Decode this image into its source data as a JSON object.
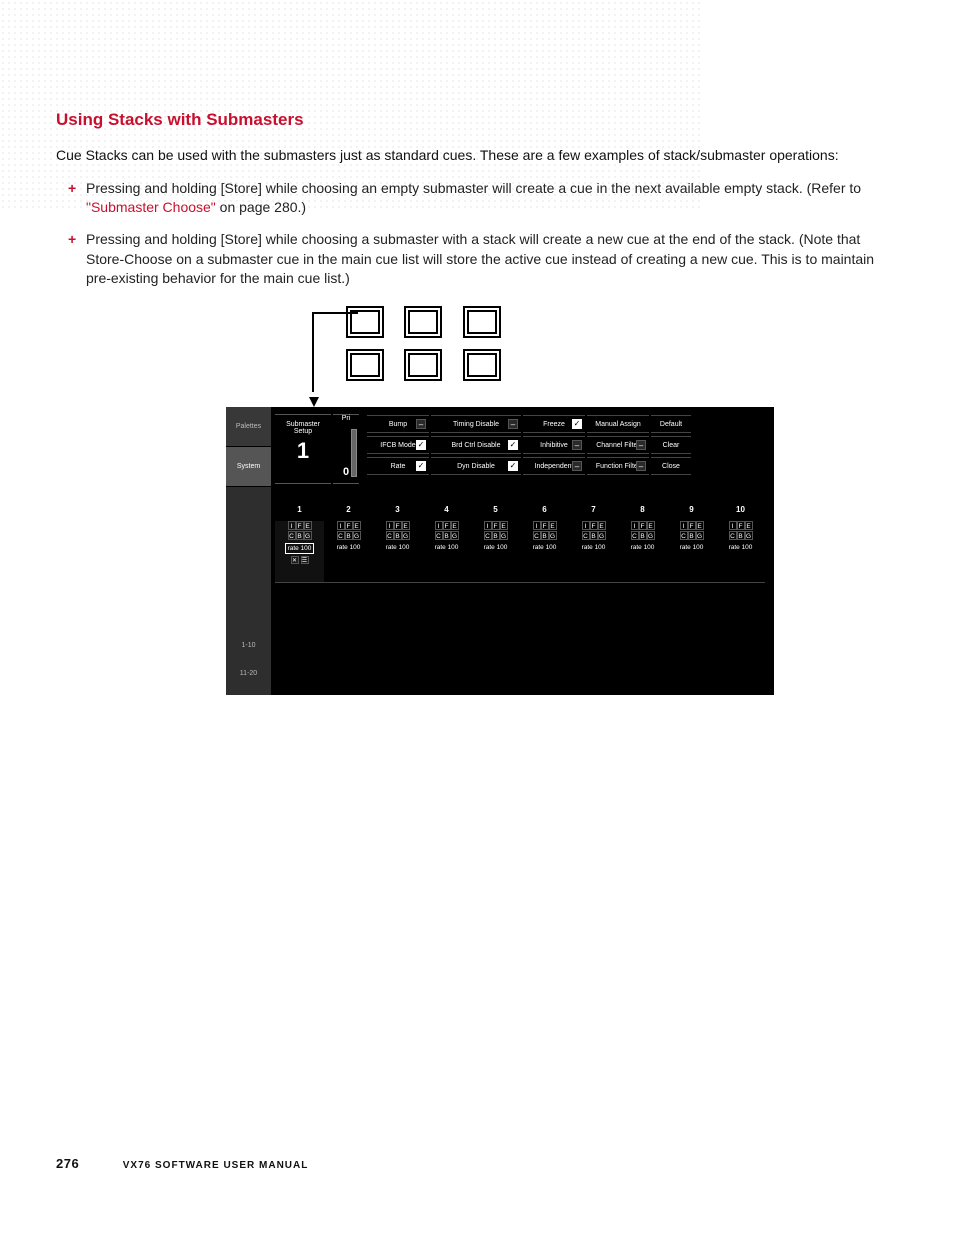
{
  "page": {
    "number": "276",
    "manual": "VX76 SOFTWARE USER MANUAL"
  },
  "heading": "Using Stacks with Submasters",
  "intro": "Cue Stacks can be used with the submasters just as standard cues. These are a few examples of stack/submaster operations:",
  "bullets": [
    {
      "pre": "Pressing and holding [Store] while choosing an empty submaster will create a cue in the next available empty stack. (Refer to ",
      "link": "\"Submaster Choose\"",
      "post": " on page 280.)"
    },
    {
      "pre": "Pressing and holding [Store] while choosing a submaster with a stack will create a new cue at the end of the stack. (Note that Store-Choose on a submaster cue in the main cue list will store the active cue instead of creating a new cue. This is to maintain pre-existing behavior for the main cue list.)",
      "link": "",
      "post": ""
    }
  ],
  "panel": {
    "sidebar": {
      "tab1": "Palettes",
      "tab2": "System",
      "range1": "1-10",
      "range2": "11-20"
    },
    "setup": {
      "label": "Submaster\nSetup",
      "num": "1",
      "pri_label": "Pri",
      "pri_value": "0"
    },
    "toggles_row1": [
      {
        "label": "Bump",
        "state": "dash",
        "w": "w60"
      },
      {
        "label": "Timing Disable",
        "state": "dash",
        "w": "w90"
      },
      {
        "label": "Freeze",
        "state": "tick",
        "w": "w60"
      },
      {
        "label": "Manual Assign",
        "state": "",
        "w": "w60"
      },
      {
        "label": "Default",
        "state": "",
        "w": "w40"
      }
    ],
    "toggles_row2": [
      {
        "label": "IFCB Mode",
        "state": "tick",
        "w": "w60"
      },
      {
        "label": "Brd Ctrl Disable",
        "state": "tick",
        "w": "w90"
      },
      {
        "label": "Inhibitive",
        "state": "dash",
        "w": "w60"
      },
      {
        "label": "Channel Filter",
        "state": "dash",
        "w": "w60"
      },
      {
        "label": "Clear",
        "state": "",
        "w": "w40"
      }
    ],
    "toggles_row3": [
      {
        "label": "Rate",
        "state": "tick",
        "w": "w60"
      },
      {
        "label": "Dyn Disable",
        "state": "tick",
        "w": "w90"
      },
      {
        "label": "Independent",
        "state": "dash",
        "w": "w60"
      },
      {
        "label": "Function Filter",
        "state": "dash",
        "w": "w60"
      },
      {
        "label": "Close",
        "state": "",
        "w": "w40"
      }
    ],
    "columns": [
      "1",
      "2",
      "3",
      "4",
      "5",
      "6",
      "7",
      "8",
      "9",
      "10"
    ],
    "sub_letters_row1": [
      "I",
      "F",
      "E"
    ],
    "sub_letters_row2": [
      "C",
      "B",
      "G"
    ],
    "sub_rate": "rate 100",
    "sub_extra": [
      "✕",
      "☰"
    ]
  }
}
